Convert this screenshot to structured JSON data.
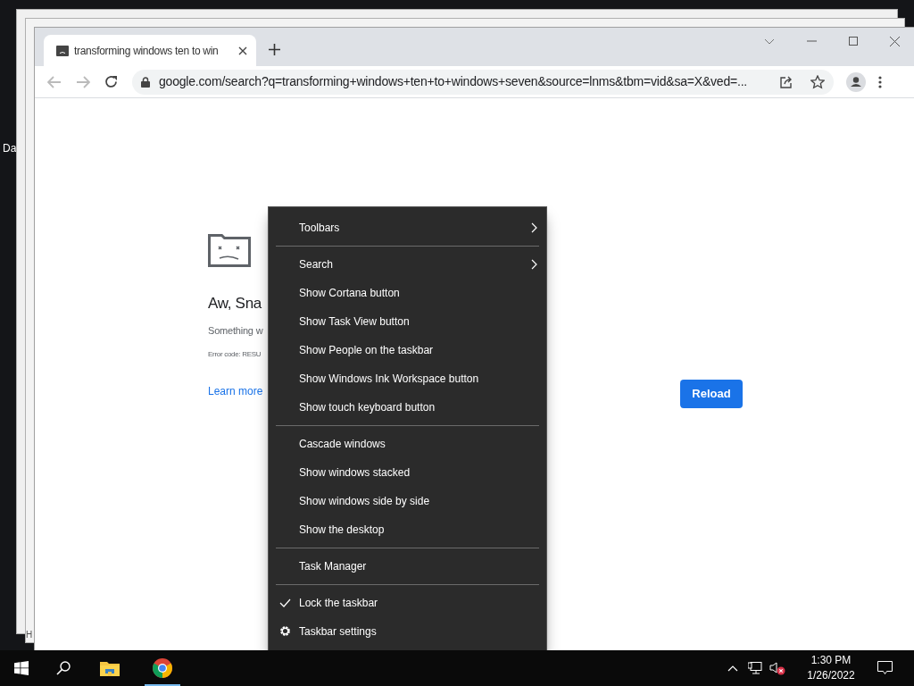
{
  "desktop": {
    "icon_label": "Da"
  },
  "back_window": {
    "status_text": "H"
  },
  "browser": {
    "tab": {
      "title": "transforming windows ten to win",
      "selected": true
    },
    "address": "google.com/search?q=transforming+windows+ten+to+windows+seven&source=lnms&tbm=vid&sa=X&ved=...",
    "error_page": {
      "heading": "Aw, Sna",
      "message": "Something w",
      "error_code": "Error code: RESU",
      "link": "Learn more",
      "button": "Reload"
    }
  },
  "context_menu": {
    "items": [
      {
        "kind": "submenu",
        "label": "Toolbars"
      },
      {
        "kind": "separator"
      },
      {
        "kind": "submenu",
        "label": "Search"
      },
      {
        "kind": "command",
        "label": "Show Cortana button"
      },
      {
        "kind": "command",
        "label": "Show Task View button"
      },
      {
        "kind": "command",
        "label": "Show People on the taskbar"
      },
      {
        "kind": "command",
        "label": "Show Windows Ink Workspace button"
      },
      {
        "kind": "command",
        "label": "Show touch keyboard button"
      },
      {
        "kind": "separator"
      },
      {
        "kind": "command",
        "label": "Cascade windows"
      },
      {
        "kind": "command",
        "label": "Show windows stacked"
      },
      {
        "kind": "command",
        "label": "Show windows side by side"
      },
      {
        "kind": "command",
        "label": "Show the desktop"
      },
      {
        "kind": "separator"
      },
      {
        "kind": "command",
        "label": "Task Manager"
      },
      {
        "kind": "separator"
      },
      {
        "kind": "toggle",
        "label": "Lock the taskbar",
        "checked": true
      },
      {
        "kind": "settings",
        "label": "Taskbar settings"
      }
    ]
  },
  "taskbar": {
    "time": "1:30 PM",
    "date": "1/26/2022"
  }
}
